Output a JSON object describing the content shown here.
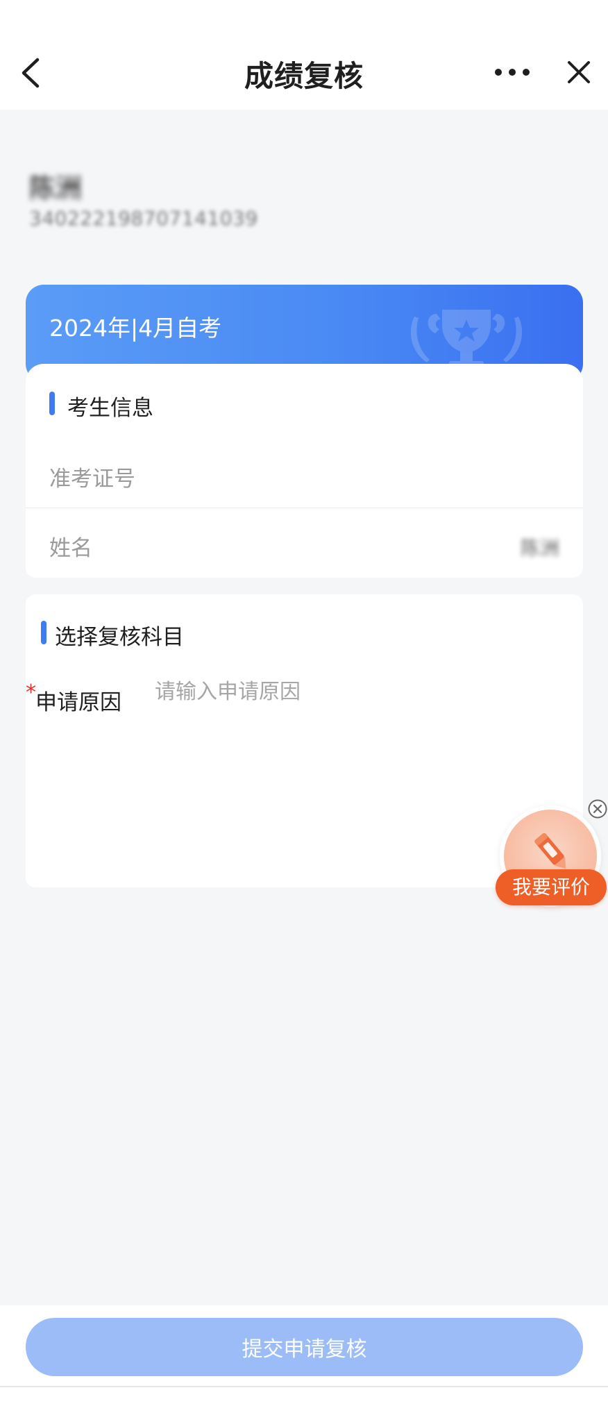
{
  "nav": {
    "title": "成绩复核"
  },
  "profile": {
    "name": "陈洲",
    "id_number": "340222198707141039"
  },
  "exam": {
    "title": "2024年|4月自考"
  },
  "candidate_info": {
    "section_title": "考生信息",
    "rows": [
      {
        "label": "准考证号",
        "value": ""
      },
      {
        "label": "姓名",
        "value": "陈洲"
      }
    ]
  },
  "subject": {
    "section_title": "选择复核科目",
    "required_mark": "*",
    "reason_label": "申请原因",
    "reason_placeholder": "请输入申请原因"
  },
  "floating": {
    "label": "我要评价"
  },
  "footer": {
    "submit_label": "提交申请复核"
  },
  "colors": {
    "accent": "#3f7bf2",
    "header_gradient_start": "#5a9cf6",
    "header_gradient_end": "#3a6ff0",
    "submit_disabled": "#9bbcf7",
    "fab_orange": "#ee5e27",
    "required_red": "#e0322e"
  }
}
